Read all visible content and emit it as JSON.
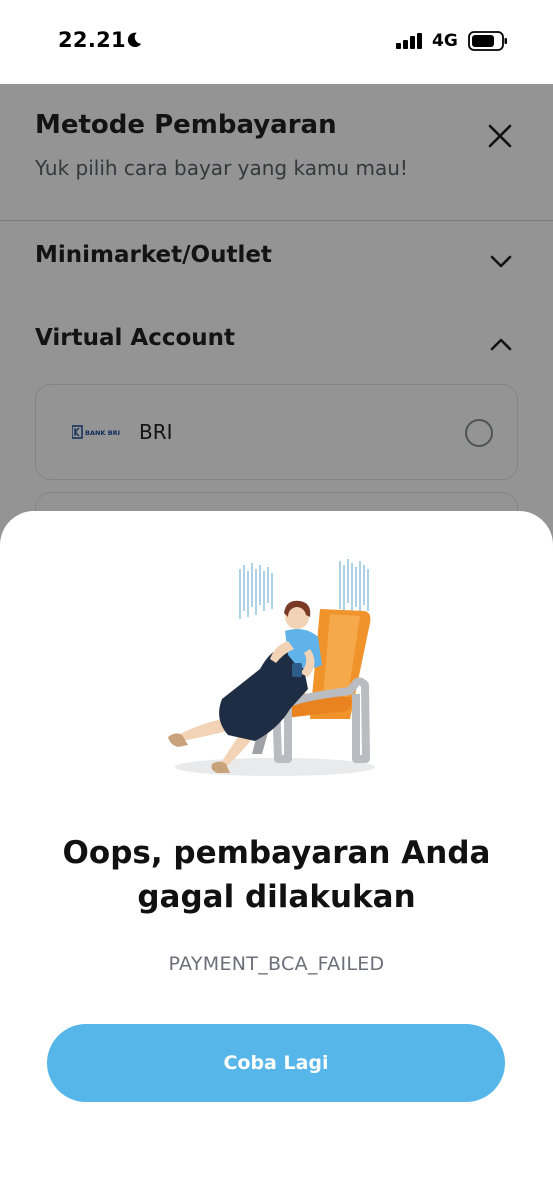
{
  "status_bar": {
    "time": "22.21",
    "network": "4G",
    "icons": [
      "moon-icon",
      "signal-icon",
      "battery-icon"
    ]
  },
  "header": {
    "title": "Metode Pembayaran",
    "subtitle": "Yuk pilih cara bayar yang kamu mau!",
    "close_icon": "close-icon"
  },
  "sections": [
    {
      "label": "Minimarket/Outlet",
      "state": "collapsed",
      "icon": "chevron-down-icon"
    },
    {
      "label": "Virtual Account",
      "state": "expanded",
      "icon": "chevron-up-icon"
    }
  ],
  "virtual_account_options": [
    {
      "logo_text": "BANK BRI",
      "name": "BRI",
      "selected": false
    }
  ],
  "error_sheet": {
    "title": "Oops, pembayaran Anda gagal dilakukan",
    "code": "PAYMENT_BCA_FAILED",
    "retry_label": "Coba Lagi",
    "illustration": "woman-sitting-in-chair-illustration"
  },
  "colors": {
    "primary_button": "#56b6ea",
    "overlay": "rgba(0,0,0,0.42)",
    "chair": "#f0932b",
    "dress": "#1f2d44",
    "shirt": "#5fb3e8"
  }
}
